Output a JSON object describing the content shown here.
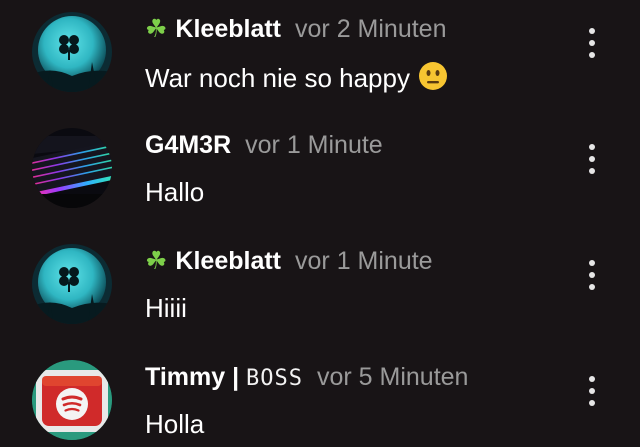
{
  "comments": [
    {
      "author": "Kleeblatt",
      "author_prefix_icon": "clover-icon",
      "time": "vor 2 Minuten",
      "text": "War noch nie so happy",
      "text_emoji": "neutral-face-emoji",
      "avatar": "moon-clover-avatar"
    },
    {
      "author": "G4M3R",
      "time": "vor 1 Minute",
      "text": "Hallo",
      "avatar": "rgb-keyboard-avatar"
    },
    {
      "author": "Kleeblatt",
      "author_prefix_icon": "clover-icon",
      "time": "vor 1 Minute",
      "text": "Hiiii",
      "avatar": "moon-clover-avatar"
    },
    {
      "author": "Timmy | ",
      "author_badge": "BOSS",
      "time": "vor 5 Minuten",
      "text": "Holla",
      "avatar": "spotify-cube-avatar"
    }
  ],
  "colors": {
    "background": "#181416",
    "author": "#ffffff",
    "timestamp": "#9a9a9a",
    "clover": "#7dcf4a"
  }
}
